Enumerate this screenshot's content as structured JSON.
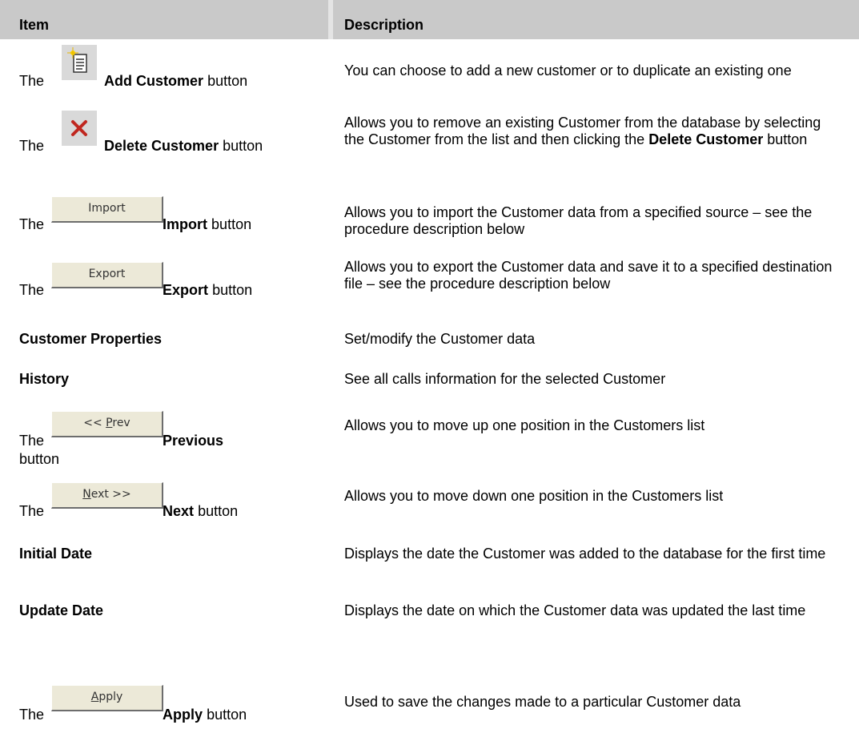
{
  "header": {
    "item": "Item",
    "description": "Description"
  },
  "rows": [
    {
      "prefix": "The",
      "bold": "Add Customer",
      "suffix": "button",
      "icon": "add-customer-icon",
      "desc": "You can choose to add a new customer or to duplicate an existing one"
    },
    {
      "prefix": "The",
      "bold": "Delete Customer",
      "suffix": "button",
      "icon": "delete-x-icon",
      "desc_pre": "Allows you to remove an existing Customer from the database by selecting the Customer from the list and then clicking the ",
      "desc_bold": "Delete Customer",
      "desc_post": " button"
    },
    {
      "prefix": "The",
      "bold": "Import",
      "suffix": "button",
      "btn_label": "Import",
      "desc": "Allows you to import the Customer data from a specified source – see the procedure description below"
    },
    {
      "prefix": "The",
      "bold": "Export",
      "suffix": "button",
      "btn_label": "Export",
      "desc": "Allows you to export the Customer data and save it to a specified destination file – see the procedure description below"
    },
    {
      "label": "Customer Properties",
      "desc": "Set/modify the Customer data"
    },
    {
      "label": "History",
      "desc": "See all calls information for the selected Customer"
    },
    {
      "prefix": "The",
      "bold": "Previous",
      "suffix": "button",
      "btn_label_pre": "<< ",
      "btn_label_u": "P",
      "btn_label_post": "rev",
      "desc": "Allows you to move up one position in the Customers list"
    },
    {
      "prefix": "The",
      "bold": "Next",
      "suffix": "button",
      "btn_label_u": "N",
      "btn_label_post": "ext >>",
      "desc": "Allows you to move down one position in the Customers list"
    },
    {
      "label": "Initial Date",
      "desc": "Displays the date the Customer was added to the database for the first time"
    },
    {
      "label": "Update Date",
      "desc": "Displays the date on which the Customer data was updated the last time"
    },
    {
      "prefix": "The",
      "bold": "Apply",
      "suffix": "button",
      "btn_label_u": "A",
      "btn_label_post": "pply",
      "desc": "Used to save the changes made to a particular Customer data"
    }
  ]
}
